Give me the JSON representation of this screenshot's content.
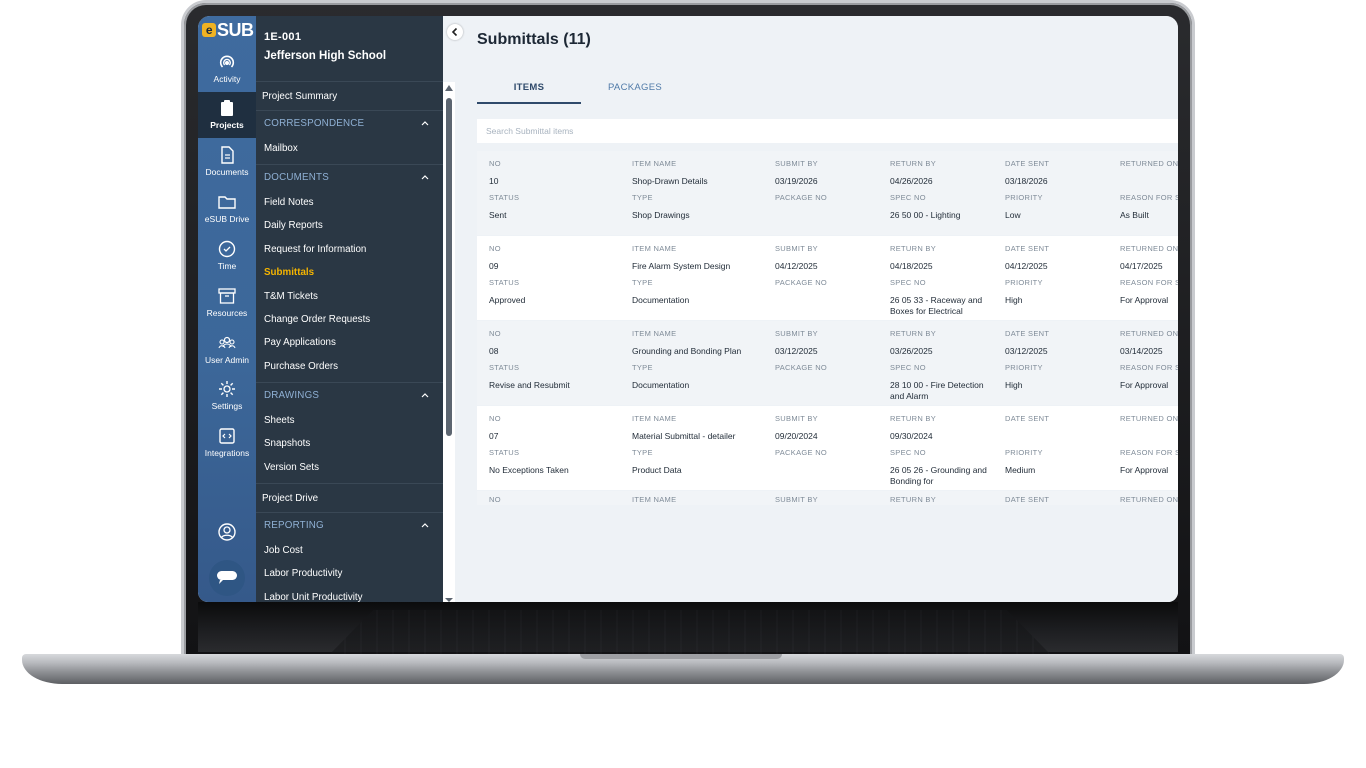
{
  "app": {
    "logo": "SUB",
    "logo_mark": "e"
  },
  "rail": {
    "items": [
      {
        "label": "Activity",
        "icon": "activity-icon"
      },
      {
        "label": "Projects",
        "icon": "clipboard-icon"
      },
      {
        "label": "Documents",
        "icon": "document-icon"
      },
      {
        "label": "eSUB Drive",
        "icon": "folder-icon"
      },
      {
        "label": "Time",
        "icon": "clock-icon"
      },
      {
        "label": "Resources",
        "icon": "archive-icon"
      },
      {
        "label": "User Admin",
        "icon": "users-icon"
      },
      {
        "label": "Settings",
        "icon": "gear-icon"
      },
      {
        "label": "Integrations",
        "icon": "integrations-icon"
      }
    ]
  },
  "project": {
    "code": "1E-001",
    "name": "Jefferson High School"
  },
  "nav": {
    "project_summary": "Project Summary",
    "correspondence": {
      "title": "CORRESPONDENCE",
      "items": [
        "Mailbox"
      ]
    },
    "documents": {
      "title": "DOCUMENTS",
      "items": [
        "Field Notes",
        "Daily Reports",
        "Request for Information",
        "Submittals",
        "T&M Tickets",
        "Change Order Requests",
        "Pay Applications",
        "Purchase Orders"
      ]
    },
    "drawings": {
      "title": "DRAWINGS",
      "items": [
        "Sheets",
        "Snapshots",
        "Version Sets"
      ]
    },
    "project_drive": "Project Drive",
    "reporting": {
      "title": "REPORTING",
      "items": [
        "Job Cost",
        "Labor Productivity",
        "Labor Unit Productivity"
      ]
    }
  },
  "main": {
    "title": "Submittals (11)",
    "tabs": [
      {
        "label": "ITEMS",
        "active": true
      },
      {
        "label": "PACKAGES",
        "active": false
      }
    ],
    "search_placeholder": "Search Submittal items",
    "labels": {
      "no": "NO",
      "item_name": "ITEM NAME",
      "submit_by": "SUBMIT BY",
      "return_by": "RETURN BY",
      "date_sent": "DATE SENT",
      "returned_on": "RETURNED ON",
      "status": "STATUS",
      "type": "TYPE",
      "package_no": "PACKAGE NO",
      "spec_no": "SPEC NO",
      "priority": "PRIORITY",
      "reason": "REASON FOR S"
    },
    "rows": [
      {
        "no": "10",
        "item_name": "Shop-Drawn Details",
        "submit_by": "03/19/2026",
        "return_by": "04/26/2026",
        "date_sent": "03/18/2026",
        "returned_on": "",
        "status": "Sent",
        "type": "Shop Drawings",
        "package_no": "",
        "spec_no": "26 50 00 - Lighting",
        "priority": "Low",
        "reason": "As Built"
      },
      {
        "no": "09",
        "item_name": "Fire Alarm System Design",
        "submit_by": "04/12/2025",
        "return_by": "04/18/2025",
        "date_sent": "04/12/2025",
        "returned_on": "04/17/2025",
        "status": "Approved",
        "type": "Documentation",
        "package_no": "",
        "spec_no": "26 05 33 - Raceway and Boxes for Electrical",
        "priority": "High",
        "reason": "For Approval"
      },
      {
        "no": "08",
        "item_name": "Grounding and Bonding Plan",
        "submit_by": "03/12/2025",
        "return_by": "03/26/2025",
        "date_sent": "03/12/2025",
        "returned_on": "03/14/2025",
        "status": "Revise and Resubmit",
        "type": "Documentation",
        "package_no": "",
        "spec_no": "28 10 00 - Fire Detection and Alarm",
        "priority": "High",
        "reason": "For Approval"
      },
      {
        "no": "07",
        "item_name": "Material Submittal - detailer",
        "submit_by": "09/20/2024",
        "return_by": "09/30/2024",
        "date_sent": "",
        "returned_on": "",
        "status": "No Exceptions Taken",
        "type": "Product Data",
        "package_no": "",
        "spec_no": "26 05 26 - Grounding and Bonding for",
        "priority": "Medium",
        "reason": "For Approval"
      }
    ]
  }
}
